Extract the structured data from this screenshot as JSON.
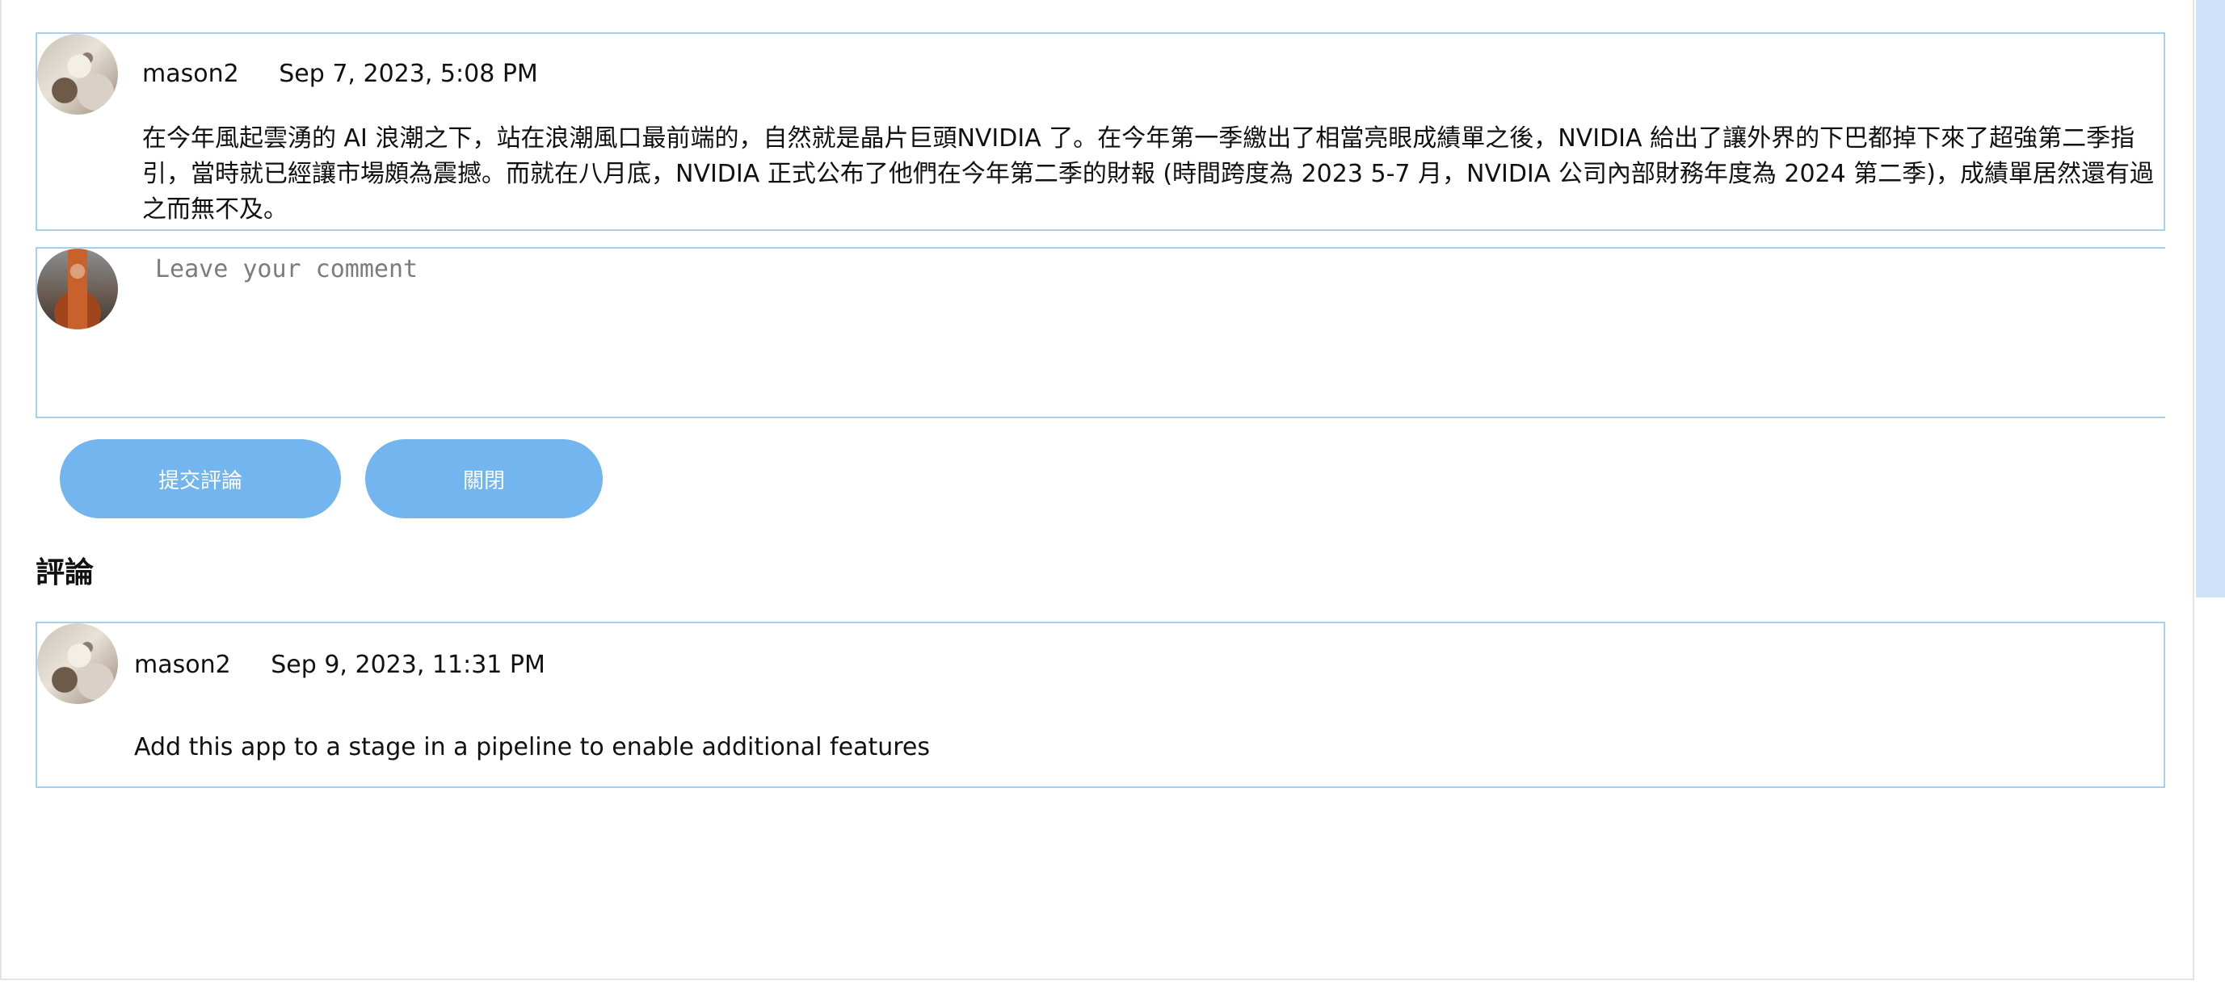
{
  "post": {
    "author": "mason2",
    "timestamp": "Sep 7, 2023, 5:08 PM",
    "body": "在今年風起雲湧的 AI 浪潮之下，站在浪潮風口最前端的，自然就是晶片巨頭NVIDIA 了。在今年第一季繳出了相當亮眼成績單之後，NVIDIA 給出了讓外界的下巴都掉下來了超強第二季指引，當時就已經讓市場頗為震撼。而就在八月底，NVIDIA 正式公布了他們在今年第二季的財報 (時間跨度為 2023 5-7 月，NVIDIA 公司內部財務年度為 2024 第二季)，成績單居然還有過之而無不及。"
  },
  "comment_form": {
    "placeholder": "Leave your comment",
    "submit_label": "提交評論",
    "close_label": "關閉"
  },
  "comments_section": {
    "title": "評論",
    "items": [
      {
        "author": "mason2",
        "timestamp": "Sep 9, 2023, 11:31 PM",
        "text": "Add this app to a stage in a pipeline to enable additional features"
      }
    ]
  },
  "colors": {
    "accent": "#73b5ee",
    "card_border": "#a7d0ef"
  }
}
